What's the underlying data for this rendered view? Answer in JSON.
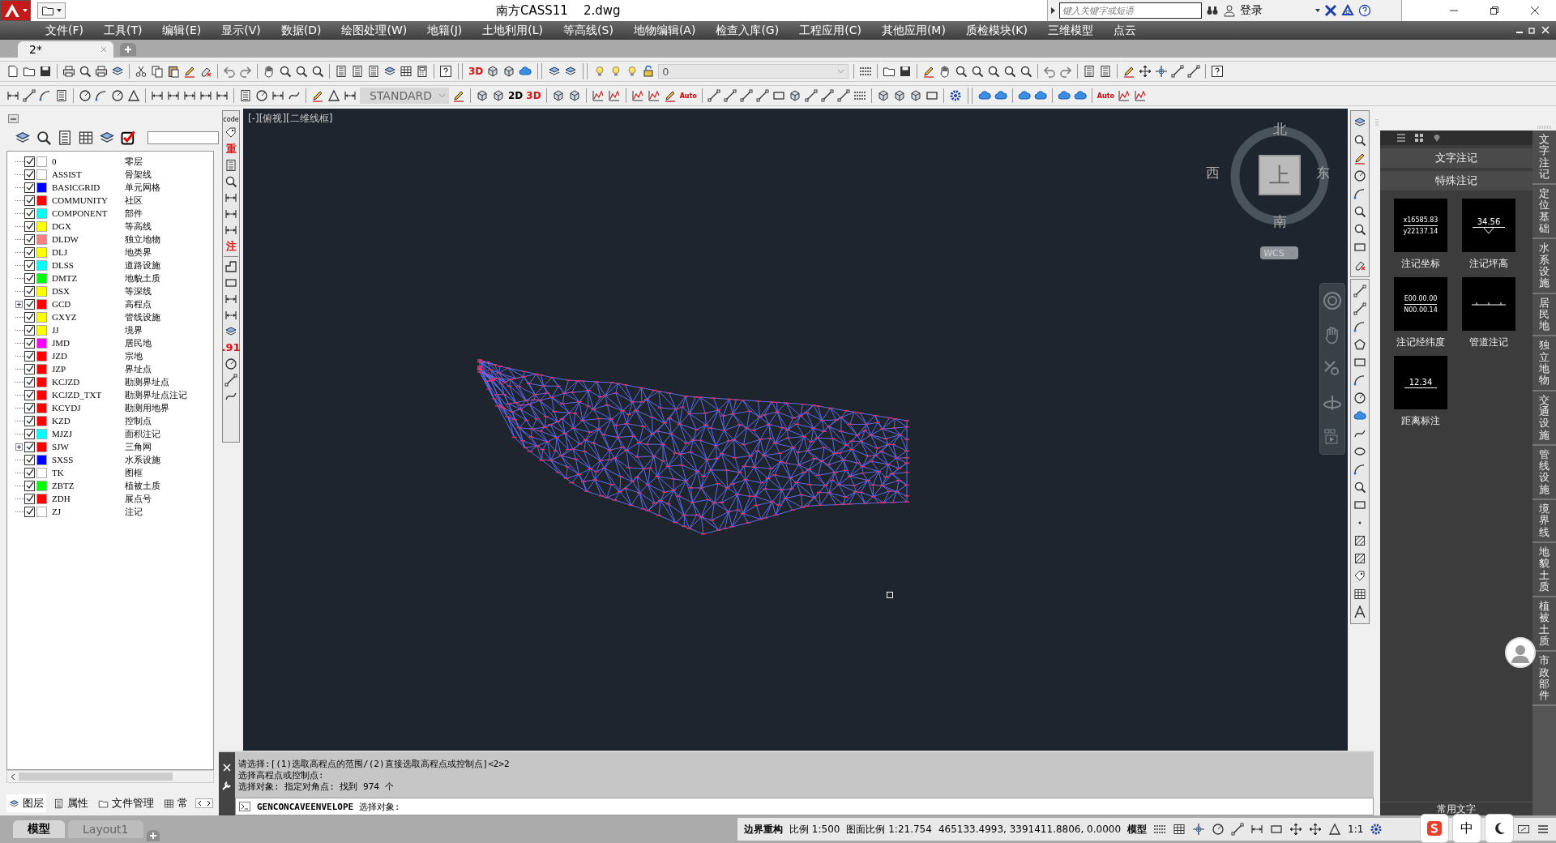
{
  "title_bar": {
    "title": "南方CASS11    2.dwg",
    "search_placeholder": "键入关键字或短语",
    "login": "登录"
  },
  "menu": [
    "文件(F)",
    "工具(T)",
    "编辑(E)",
    "显示(V)",
    "数据(D)",
    "绘图处理(W)",
    "地籍(J)",
    "土地利用(L)",
    "等高线(S)",
    "地物编辑(A)",
    "检查入库(G)",
    "工程应用(C)",
    "其他应用(M)",
    "质检模块(K)",
    "三维模型",
    "点云"
  ],
  "doc_tabs": [
    {
      "label": "2*",
      "selected": true
    }
  ],
  "toolbar": {
    "badge_3d": "3D",
    "current_layer": "0",
    "text_style": "STANDARD",
    "mode_2d": "2D",
    "mode_3d": "3D",
    "auto_a": "Auto",
    "auto_b": "Auto"
  },
  "layer_panel": {
    "layers": [
      {
        "name": "0",
        "desc": "零层",
        "color": "#ffffff",
        "checked": true,
        "expandable": false
      },
      {
        "name": "ASSIST",
        "desc": "骨架线",
        "color": "#ffffff",
        "checked": true,
        "expandable": false
      },
      {
        "name": "BASICGRID",
        "desc": "单元网格",
        "color": "#0000ff",
        "checked": true,
        "expandable": false
      },
      {
        "name": "COMMUNITY",
        "desc": "社区",
        "color": "#ff0000",
        "checked": true,
        "expandable": false
      },
      {
        "name": "COMPONENT",
        "desc": "部件",
        "color": "#00ffff",
        "checked": true,
        "expandable": false
      },
      {
        "name": "DGX",
        "desc": "等高线",
        "color": "#ffff00",
        "checked": true,
        "expandable": false
      },
      {
        "name": "DLDW",
        "desc": "独立地物",
        "color": "#ff8080",
        "checked": true,
        "expandable": false
      },
      {
        "name": "DLJ",
        "desc": "地类界",
        "color": "#ffff00",
        "checked": true,
        "expandable": false
      },
      {
        "name": "DLSS",
        "desc": "道路设施",
        "color": "#00ffff",
        "checked": true,
        "expandable": false
      },
      {
        "name": "DMTZ",
        "desc": "地貌土质",
        "color": "#00ff00",
        "checked": true,
        "expandable": false
      },
      {
        "name": "DSX",
        "desc": "等深线",
        "color": "#ffff00",
        "checked": true,
        "expandable": false
      },
      {
        "name": "GCD",
        "desc": "高程点",
        "color": "#ff0000",
        "checked": true,
        "expandable": true
      },
      {
        "name": "GXYZ",
        "desc": "管线设施",
        "color": "#ffff00",
        "checked": true,
        "expandable": false
      },
      {
        "name": "JJ",
        "desc": "境界",
        "color": "#ffff00",
        "checked": true,
        "expandable": false
      },
      {
        "name": "JMD",
        "desc": "居民地",
        "color": "#ff00ff",
        "checked": true,
        "expandable": false
      },
      {
        "name": "JZD",
        "desc": "宗地",
        "color": "#ff0000",
        "checked": true,
        "expandable": false
      },
      {
        "name": "JZP",
        "desc": "界址点",
        "color": "#ff0000",
        "checked": true,
        "expandable": false
      },
      {
        "name": "KCJZD",
        "desc": "勘测界址点",
        "color": "#ff0000",
        "checked": true,
        "expandable": false
      },
      {
        "name": "KCJZD_TXT",
        "desc": "勘测界址点注记",
        "color": "#ff0000",
        "checked": true,
        "expandable": false
      },
      {
        "name": "KCYDJ",
        "desc": "勘测用地界",
        "color": "#ff0000",
        "checked": true,
        "expandable": false
      },
      {
        "name": "KZD",
        "desc": "控制点",
        "color": "#ff0000",
        "checked": true,
        "expandable": false
      },
      {
        "name": "MJZJ",
        "desc": "面积注记",
        "color": "#00ffff",
        "checked": true,
        "expandable": false
      },
      {
        "name": "SJW",
        "desc": "三角网",
        "color": "#ff0000",
        "checked": true,
        "expandable": true
      },
      {
        "name": "SXSS",
        "desc": "水系设施",
        "color": "#0000ff",
        "checked": true,
        "expandable": false
      },
      {
        "name": "TK",
        "desc": "图框",
        "color": "#ffffff",
        "checked": true,
        "expandable": false
      },
      {
        "name": "ZBTZ",
        "desc": "植被土质",
        "color": "#00ff00",
        "checked": true,
        "expandable": false
      },
      {
        "name": "ZDH",
        "desc": "展点号",
        "color": "#ff0000",
        "checked": true,
        "expandable": false
      },
      {
        "name": "ZJ",
        "desc": "注记",
        "color": "#ffffff",
        "checked": true,
        "expandable": false
      }
    ],
    "tabs": [
      {
        "label": "图层",
        "selected": true
      },
      {
        "label": "属性",
        "selected": false
      },
      {
        "label": "文件管理",
        "selected": false
      },
      {
        "label": "常",
        "selected": false
      }
    ]
  },
  "tool_strip": {
    "code": "code",
    "heavy": "重",
    "note": "注",
    "number": ".91"
  },
  "viewport": {
    "label": "[-][俯视][二维线框]",
    "compass": {
      "north": "北",
      "west": "西",
      "east": "东",
      "south": "南",
      "top": "上"
    },
    "ucs": "WCS"
  },
  "command": {
    "history": [
      "请选择:[(1)选取高程点的范围/(2)直接选取高程点或控制点]<2>2",
      "选择高程点或控制点:",
      "选择对象: 指定对角点: 找到 974 个"
    ],
    "prompt": "**GENCONCAVEENVELOPE** 选择对象:"
  },
  "layout_tabs": [
    {
      "label": "模型",
      "selected": true
    },
    {
      "label": "Layout1",
      "selected": false
    }
  ],
  "status_bar": {
    "items": [
      "边界重构",
      "比例 1:500",
      "图面比例 1:21.754",
      "465133.4993, 3391411.8806, 0.0000",
      "模型"
    ],
    "scale": "1:1"
  },
  "palette": {
    "sections": [
      "文字注记",
      "特殊注记"
    ],
    "items": [
      {
        "kind": "coordinate",
        "preview": [
          "x16585.83",
          "y22137.14"
        ],
        "label": "注记坐标"
      },
      {
        "kind": "elevation",
        "preview": [
          "34.56"
        ],
        "label": "注记坪高"
      },
      {
        "kind": "coordinate",
        "preview": [
          "E00.00.00",
          "N00.00.14"
        ],
        "label": "注记经纬度"
      },
      {
        "kind": "pipe",
        "label": "管道注记"
      },
      {
        "kind": "distance",
        "preview": [
          "12.34"
        ],
        "label": "距离标注"
      }
    ],
    "footer": "常用文字",
    "side_tabs": [
      "文字注记",
      "定位基础",
      "水系设施",
      "居民地",
      "独立地物",
      "交通设施",
      "管线设施",
      "境界线",
      "地貌土质",
      "植被土质",
      "市政部件"
    ]
  },
  "ime": {
    "mode": "中"
  }
}
